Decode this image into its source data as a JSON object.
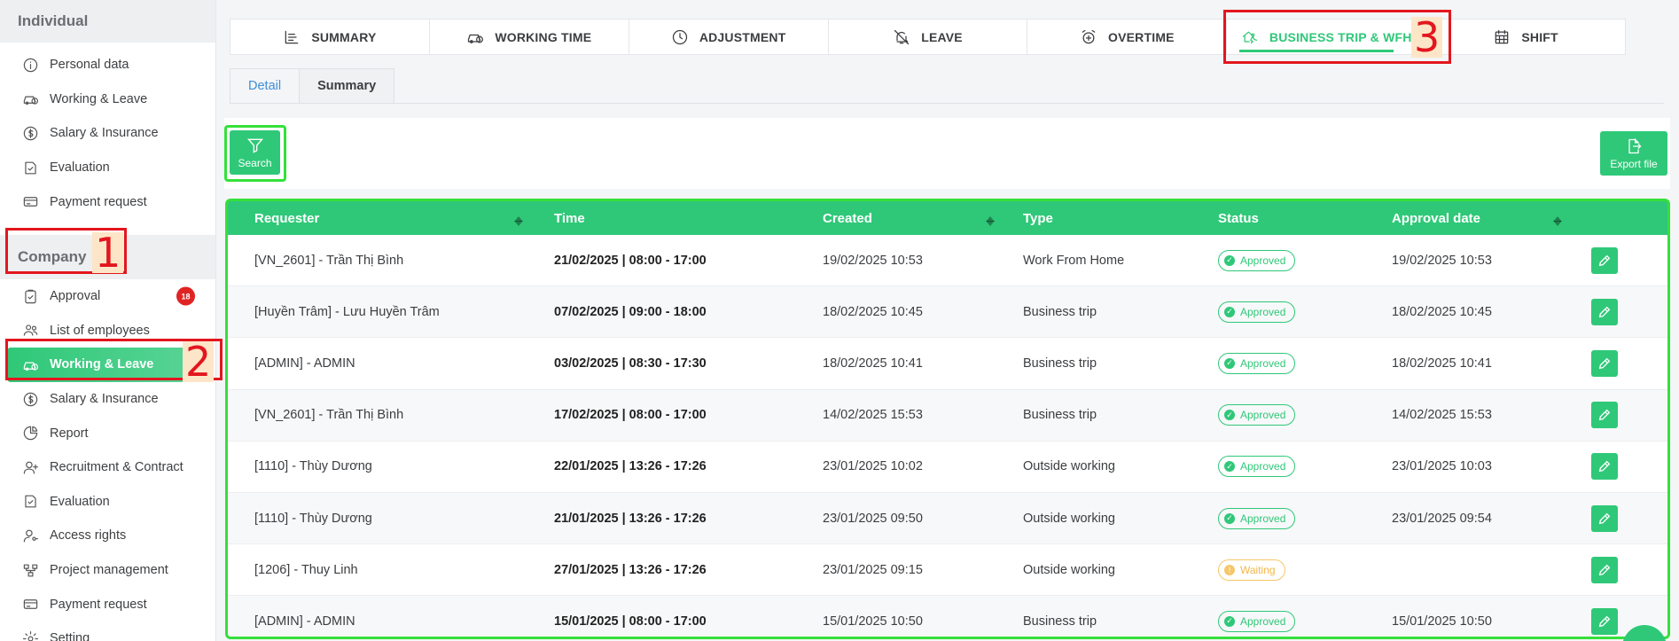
{
  "sidebar": {
    "individual_header": "Individual",
    "individual_items": [
      {
        "label": "Personal data",
        "icon": "info-icon"
      },
      {
        "label": "Working & Leave",
        "icon": "car-clock-icon"
      },
      {
        "label": "Salary & Insurance",
        "icon": "dollar-circle-icon"
      },
      {
        "label": "Evaluation",
        "icon": "evaluation-icon"
      },
      {
        "label": "Payment request",
        "icon": "payment-icon"
      }
    ],
    "company_header": "Company",
    "company_items": [
      {
        "label": "Approval",
        "icon": "clipboard-check-icon",
        "badge": "18"
      },
      {
        "label": "List of employees",
        "icon": "people-icon"
      },
      {
        "label": "Working & Leave",
        "icon": "car-clock-icon"
      },
      {
        "label": "Salary & Insurance",
        "icon": "dollar-circle-icon"
      },
      {
        "label": "Report",
        "icon": "pie-chart-icon"
      },
      {
        "label": "Recruitment & Contract",
        "icon": "user-plus-icon"
      },
      {
        "label": "Evaluation",
        "icon": "evaluation-icon"
      },
      {
        "label": "Access rights",
        "icon": "user-key-icon"
      },
      {
        "label": "Project management",
        "icon": "project-icon"
      },
      {
        "label": "Payment request",
        "icon": "payment-icon"
      },
      {
        "label": "Setting",
        "icon": "gear-icon"
      }
    ]
  },
  "annotations": [
    "1",
    "2",
    "3"
  ],
  "top_tabs": [
    {
      "label": "SUMMARY",
      "icon": "list-icon"
    },
    {
      "label": "WORKING TIME",
      "icon": "car-clock-icon"
    },
    {
      "label": "ADJUSTMENT",
      "icon": "clock-icon"
    },
    {
      "label": "LEAVE",
      "icon": "bell-off-icon"
    },
    {
      "label": "OVERTIME",
      "icon": "alarm-plus-icon"
    },
    {
      "label": "BUSINESS TRIP & WFH",
      "icon": "home-walk-icon"
    },
    {
      "label": "SHIFT",
      "icon": "calendar-icon"
    }
  ],
  "sub_tabs": {
    "detail": "Detail",
    "summary": "Summary"
  },
  "toolbar": {
    "search_label": "Search",
    "export_label": "Export file"
  },
  "table": {
    "headers": {
      "requester": "Requester",
      "time": "Time",
      "created": "Created",
      "type": "Type",
      "status": "Status",
      "approval_date": "Approval date"
    },
    "rows": [
      {
        "requester": "[VN_2601] - Trần Thị Bình",
        "time": "21/02/2025 | 08:00 - 17:00",
        "created": "19/02/2025 10:53",
        "type": "Work From Home",
        "status": "Approved",
        "approval_date": "19/02/2025 10:53"
      },
      {
        "requester": "[Huyền Trâm] - Lưu Huyền Trâm",
        "time": "07/02/2025 | 09:00 - 18:00",
        "created": "18/02/2025 10:45",
        "type": "Business trip",
        "status": "Approved",
        "approval_date": "18/02/2025 10:45"
      },
      {
        "requester": "[ADMIN] - ADMIN",
        "time": "03/02/2025 | 08:30 - 17:30",
        "created": "18/02/2025 10:41",
        "type": "Business trip",
        "status": "Approved",
        "approval_date": "18/02/2025 10:41"
      },
      {
        "requester": "[VN_2601] - Trần Thị Bình",
        "time": "17/02/2025 | 08:00 - 17:00",
        "created": "14/02/2025 15:53",
        "type": "Business trip",
        "status": "Approved",
        "approval_date": "14/02/2025 15:53"
      },
      {
        "requester": "[1110] - Thùy Dương",
        "time": "22/01/2025 | 13:26 - 17:26",
        "created": "23/01/2025 10:02",
        "type": "Outside working",
        "status": "Approved",
        "approval_date": "23/01/2025 10:03"
      },
      {
        "requester": "[1110] - Thùy Dương",
        "time": "21/01/2025 | 13:26 - 17:26",
        "created": "23/01/2025 09:50",
        "type": "Outside working",
        "status": "Approved",
        "approval_date": "23/01/2025 09:54"
      },
      {
        "requester": "[1206] - Thuy Linh",
        "time": "27/01/2025 | 13:26 - 17:26",
        "created": "23/01/2025 09:15",
        "type": "Outside working",
        "status": "Waiting",
        "approval_date": ""
      },
      {
        "requester": "[ADMIN] - ADMIN",
        "time": "15/01/2025 | 08:00 - 17:00",
        "created": "15/01/2025 10:50",
        "type": "Business trip",
        "status": "Approved",
        "approval_date": "15/01/2025 10:50"
      }
    ]
  },
  "colors": {
    "accent": "#2fc878",
    "annotation": "#e3161e",
    "highlight": "#35e03a",
    "badge": "#e02424",
    "waiting": "#f6c66b"
  }
}
